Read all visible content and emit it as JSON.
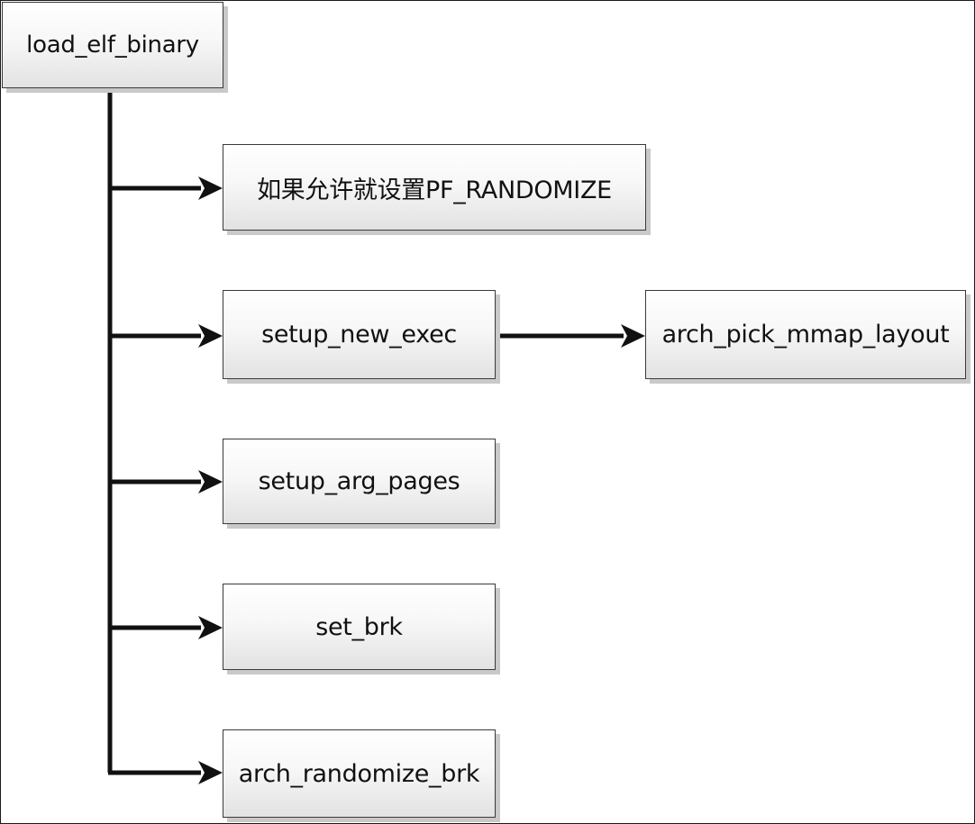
{
  "diagram": {
    "root": "load_elf_binary",
    "children": [
      "如果允许就设置PF_RANDOMIZE",
      "setup_new_exec",
      "setup_arg_pages",
      "set_brk",
      "arch_randomize_brk"
    ],
    "sub_child": "arch_pick_mmap_layout",
    "line_color": "#111111",
    "box_border_color": "#3a3a3a",
    "box_shadow_color": "#c9c9c9"
  }
}
